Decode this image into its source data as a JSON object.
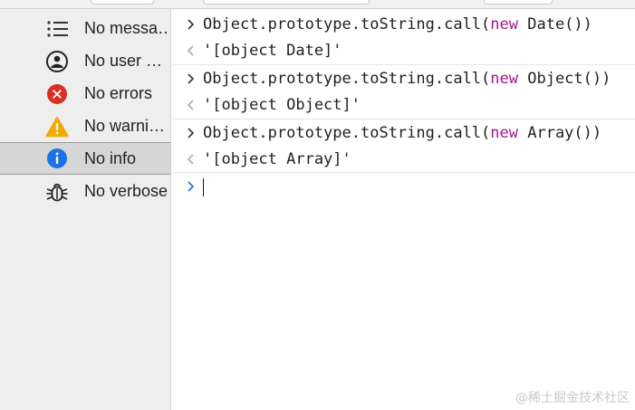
{
  "sidebar": {
    "items": [
      {
        "label": "No messa…",
        "icon": "list-icon",
        "selected": false
      },
      {
        "label": "No user …",
        "icon": "user-icon",
        "selected": false
      },
      {
        "label": "No errors",
        "icon": "error-icon",
        "selected": false
      },
      {
        "label": "No warni…",
        "icon": "warning-icon",
        "selected": false
      },
      {
        "label": "No info",
        "icon": "info-icon",
        "selected": true
      },
      {
        "label": "No verbose",
        "icon": "bug-icon",
        "selected": false
      }
    ]
  },
  "console": {
    "entries": [
      {
        "input_prefix": "Object.prototype.toString.call(",
        "input_keyword": "new",
        "input_suffix": " Date())",
        "output": "'[object Date]'"
      },
      {
        "input_prefix": "Object.prototype.toString.call(",
        "input_keyword": "new",
        "input_suffix": " Object())",
        "output": "'[object Object]'"
      },
      {
        "input_prefix": "Object.prototype.toString.call(",
        "input_keyword": "new",
        "input_suffix": " Array())",
        "output": "'[object Array]'"
      }
    ],
    "prompt_value": ""
  },
  "watermark": "@稀土掘金技术社区",
  "colors": {
    "error": "#d93025",
    "warning": "#f2a900",
    "info": "#1a73e8",
    "keyword": "#a8158f",
    "string": "#a3316f"
  }
}
